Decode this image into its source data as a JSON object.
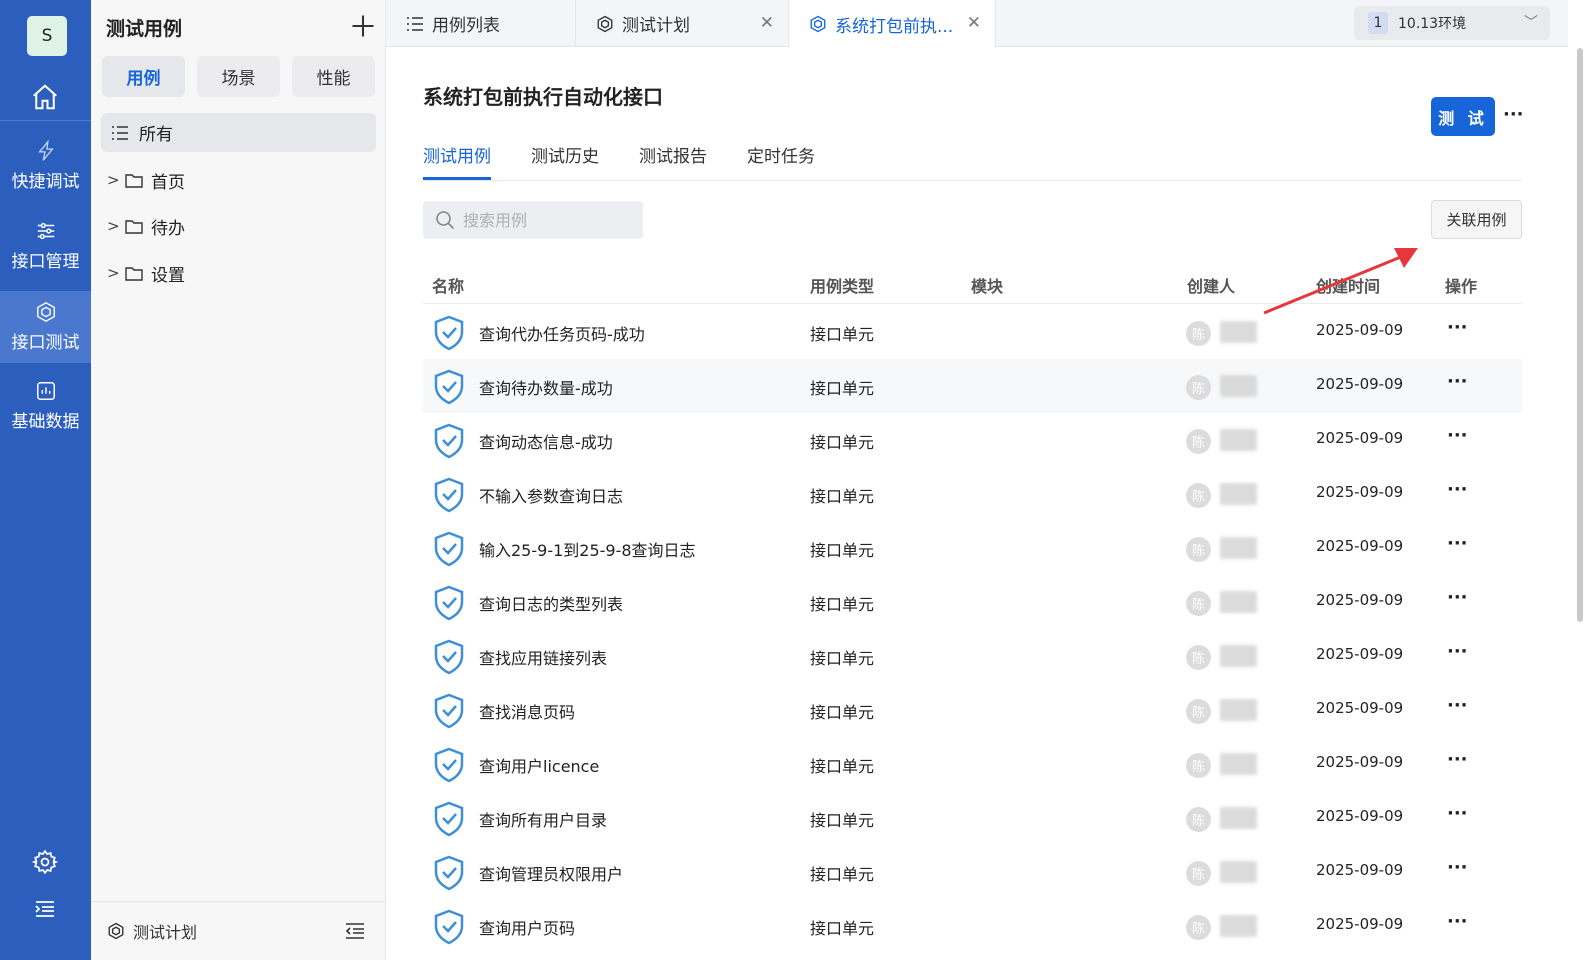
{
  "rail": {
    "logo_letter": "S",
    "items": [
      {
        "label": "快捷调试",
        "icon": "lightning-icon"
      },
      {
        "label": "接口管理",
        "icon": "sliders-icon"
      },
      {
        "label": "接口测试",
        "icon": "cube-icon",
        "active": true
      },
      {
        "label": "基础数据",
        "icon": "chart-icon"
      }
    ]
  },
  "sidebar": {
    "title": "测试用例",
    "segments": [
      "用例",
      "场景",
      "性能"
    ],
    "active_segment": "用例",
    "all_label": "所有",
    "tree": [
      "首页",
      "待办",
      "设置"
    ],
    "footer_label": "测试计划"
  },
  "tabs": [
    {
      "label": "用例列表",
      "icon": "list-icon"
    },
    {
      "label": "测试计划",
      "icon": "cube-icon",
      "closable": true
    },
    {
      "label": "系统打包前执...",
      "icon": "cube-icon",
      "closable": true,
      "active": true
    }
  ],
  "env": {
    "number": "1",
    "label": "10.13环境"
  },
  "main": {
    "title": "系统打包前执行自动化接口",
    "test_button": "测 试",
    "subtabs": [
      "测试用例",
      "测试历史",
      "测试报告",
      "定时任务"
    ],
    "active_subtab": "测试用例",
    "search_placeholder": "搜索用例",
    "link_button": "关联用例",
    "columns": [
      "名称",
      "用例类型",
      "模块",
      "创建人",
      "创建时间",
      "操作"
    ]
  },
  "rows": [
    {
      "name": "查询代办任务页码-成功",
      "type": "接口单元",
      "avatar": "陈",
      "date": "2025-09-09"
    },
    {
      "name": "查询待办数量-成功",
      "type": "接口单元",
      "avatar": "陈",
      "date": "2025-09-09"
    },
    {
      "name": "查询动态信息-成功",
      "type": "接口单元",
      "avatar": "陈",
      "date": "2025-09-09"
    },
    {
      "name": "不输入参数查询日志",
      "type": "接口单元",
      "avatar": "陈",
      "date": "2025-09-09"
    },
    {
      "name": "输入25-9-1到25-9-8查询日志",
      "type": "接口单元",
      "avatar": "陈",
      "date": "2025-09-09"
    },
    {
      "name": "查询日志的类型列表",
      "type": "接口单元",
      "avatar": "陈",
      "date": "2025-09-09"
    },
    {
      "name": "查找应用链接列表",
      "type": "接口单元",
      "avatar": "陈",
      "date": "2025-09-09"
    },
    {
      "name": "查找消息页码",
      "type": "接口单元",
      "avatar": "陈",
      "date": "2025-09-09"
    },
    {
      "name": "查询用户licence",
      "type": "接口单元",
      "avatar": "陈",
      "date": "2025-09-09"
    },
    {
      "name": "查询所有用户目录",
      "type": "接口单元",
      "avatar": "陈",
      "date": "2025-09-09"
    },
    {
      "name": "查询管理员权限用户",
      "type": "接口单元",
      "avatar": "陈",
      "date": "2025-09-09"
    },
    {
      "name": "查询用户页码",
      "type": "接口单元",
      "avatar": "陈",
      "date": "2025-09-09"
    }
  ],
  "colors": {
    "rail": "#2c5fbd",
    "accent": "#1765d8",
    "annotation_arrow": "#e5383b"
  }
}
